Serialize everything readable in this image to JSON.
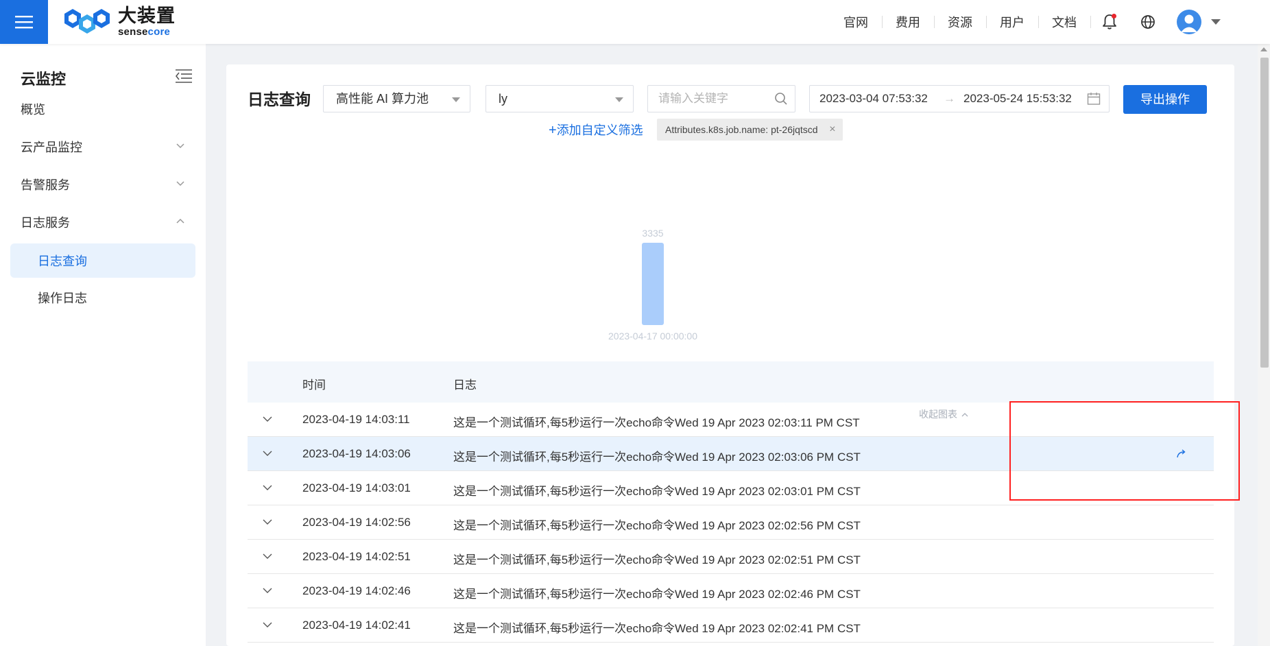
{
  "header": {
    "logo_cn": "大装置",
    "logo_en_prefix": "sense",
    "logo_en_suffix": "core",
    "nav": [
      "官网",
      "费用",
      "资源",
      "用户",
      "文档"
    ]
  },
  "sidebar": {
    "title": "云监控",
    "items": [
      {
        "label": "概览"
      },
      {
        "label": "云产品监控"
      },
      {
        "label": "告警服务"
      },
      {
        "label": "日志服务"
      }
    ],
    "subitems": [
      {
        "label": "日志查询",
        "active": true
      },
      {
        "label": "操作日志"
      }
    ]
  },
  "main": {
    "title": "日志查询",
    "pool_select": "高性能 AI 算力池",
    "project_select": "ly",
    "search_placeholder": "请输入关键字",
    "date_start": "2023-03-04 07:53:32",
    "date_sep": "→",
    "date_end": "2023-05-24 15:53:32",
    "export_label": "导出操作",
    "add_filter_label": "添加自定义筛选",
    "filter_tag": "Attributes.k8s.job.name: pt-26jqtscd",
    "collapse_chart_label": "收起图表"
  },
  "chart_data": {
    "type": "bar",
    "categories": [
      "2023-04-17 00:00:00"
    ],
    "values": [
      3335
    ],
    "title": "",
    "xlabel": "",
    "ylabel": "",
    "grid": false,
    "bar_color": "#aacdfb"
  },
  "table": {
    "columns": [
      "时间",
      "日志"
    ],
    "rows": [
      {
        "time": "2023-04-19 14:03:11",
        "log": "这是一个测试循环,每5秒运行一次echo命令Wed 19 Apr 2023 02:03:11 PM CST"
      },
      {
        "time": "2023-04-19 14:03:06",
        "log": "这是一个测试循环,每5秒运行一次echo命令Wed 19 Apr 2023 02:03:06 PM CST"
      },
      {
        "time": "2023-04-19 14:03:01",
        "log": "这是一个测试循环,每5秒运行一次echo命令Wed 19 Apr 2023 02:03:01 PM CST"
      },
      {
        "time": "2023-04-19 14:02:56",
        "log": "这是一个测试循环,每5秒运行一次echo命令Wed 19 Apr 2023 02:02:56 PM CST"
      },
      {
        "time": "2023-04-19 14:02:51",
        "log": "这是一个测试循环,每5秒运行一次echo命令Wed 19 Apr 2023 02:02:51 PM CST"
      },
      {
        "time": "2023-04-19 14:02:46",
        "log": "这是一个测试循环,每5秒运行一次echo命令Wed 19 Apr 2023 02:02:46 PM CST"
      },
      {
        "time": "2023-04-19 14:02:41",
        "log": "这是一个测试循环,每5秒运行一次echo命令Wed 19 Apr 2023 02:02:41 PM CST"
      }
    ]
  },
  "colors": {
    "accent": "#1a6fe0",
    "annotation": "#ff1f1f"
  },
  "icons": [
    "menu-icon",
    "bell-icon",
    "globe-icon",
    "user-avatar-icon",
    "search-icon",
    "calendar-icon",
    "chevron-down-icon",
    "share-icon"
  ]
}
